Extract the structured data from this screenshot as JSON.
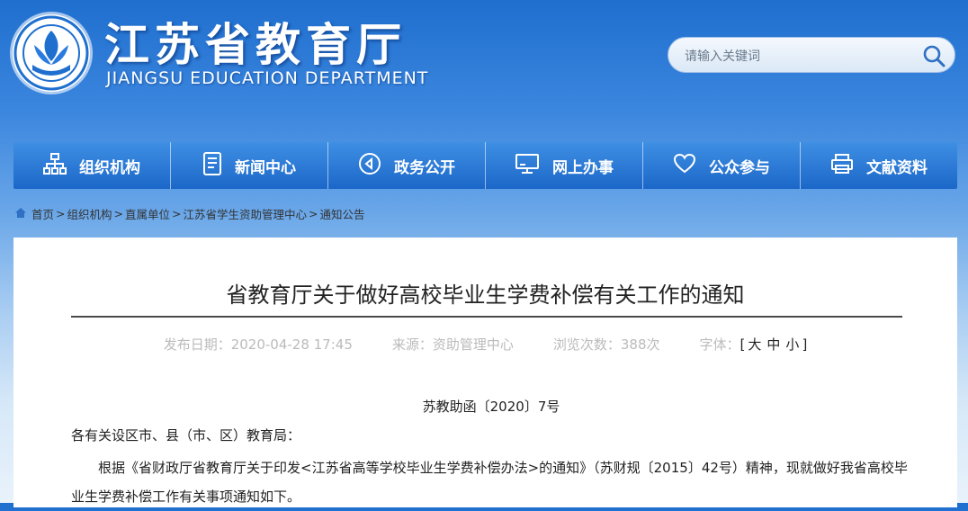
{
  "header": {
    "title": "江苏省教育厅",
    "subtitle": "JIANGSU EDUCATION DEPARTMENT",
    "logo_icon": "emblem-logo"
  },
  "search": {
    "placeholder": "请输入关键词",
    "icon": "search-icon"
  },
  "nav": {
    "items": [
      {
        "label": "组织机构",
        "icon": "org-chart-icon"
      },
      {
        "label": "新闻中心",
        "icon": "document-icon"
      },
      {
        "label": "政务公开",
        "icon": "play-circle-icon"
      },
      {
        "label": "网上办事",
        "icon": "monitor-icon"
      },
      {
        "label": "公众参与",
        "icon": "heart-icon"
      },
      {
        "label": "文献资料",
        "icon": "printer-icon"
      }
    ]
  },
  "breadcrumb": {
    "items": [
      "首页",
      "组织机构",
      "直属单位",
      "江苏省学生资助管理中心",
      "通知公告"
    ],
    "separator": ">"
  },
  "article": {
    "title": "省教育厅关于做好高校毕业生学费补偿有关工作的通知",
    "meta": {
      "date": "发布日期：2020-04-28 17:45",
      "source": "来源：资助管理中心",
      "views": "浏览次数：388次",
      "font_label": "字体：",
      "font_open": "[",
      "font_large": "大",
      "font_medium": "中",
      "font_small": "小",
      "font_close": "]"
    },
    "doc_number": "苏教助函〔2020〕7号",
    "salutation": "各有关设区市、县（市、区）教育局：",
    "body": "根据《省财政厅省教育厅关于印发<江苏省高等学校毕业生学费补偿办法>的通知》（苏财规〔2015〕42号）精神，现就做好我省高校毕业生学费补偿工作有关事项通知如下。"
  },
  "colors": {
    "nav_top": "#3f8fe4",
    "nav_bottom": "#1b67c8",
    "header_blue": "#1f6fcf",
    "meta_gray": "#bbbbbb"
  }
}
